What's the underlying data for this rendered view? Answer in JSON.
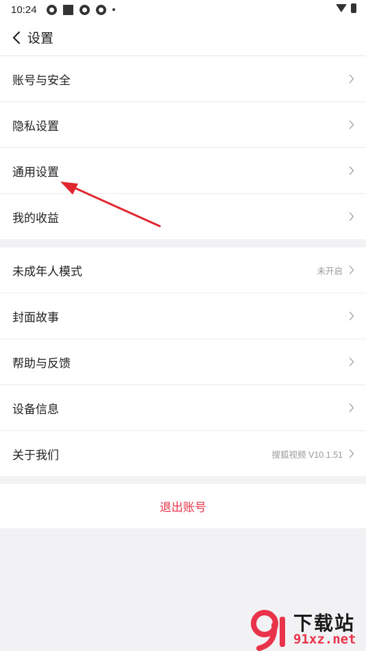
{
  "status_bar": {
    "time": "10:24",
    "icons": [
      "notification-icon",
      "notification-icon",
      "notification-icon",
      "notification-icon",
      "dot-icon",
      "wifi-icon",
      "battery-icon"
    ]
  },
  "header": {
    "title": "设置",
    "back_icon": "chevron-left-icon"
  },
  "group1": {
    "items": [
      {
        "label": "账号与安全",
        "value": ""
      },
      {
        "label": "隐私设置",
        "value": ""
      },
      {
        "label": "通用设置",
        "value": ""
      },
      {
        "label": "我的收益",
        "value": ""
      }
    ]
  },
  "group2": {
    "items": [
      {
        "label": "未成年人模式",
        "value": "未开启"
      },
      {
        "label": "封面故事",
        "value": ""
      },
      {
        "label": "帮助与反馈",
        "value": ""
      },
      {
        "label": "设备信息",
        "value": ""
      },
      {
        "label": "关于我们",
        "value": "搜狐视频 V10.1.51"
      }
    ]
  },
  "logout": {
    "label": "退出账号"
  },
  "watermark": {
    "logo_text": "下载站",
    "url_text": "91xz.net"
  },
  "colors": {
    "background": "#f2f2f4",
    "logout_red": "#e8334a",
    "annotation_red": "#e0262e",
    "secondary_text": "#999999"
  }
}
